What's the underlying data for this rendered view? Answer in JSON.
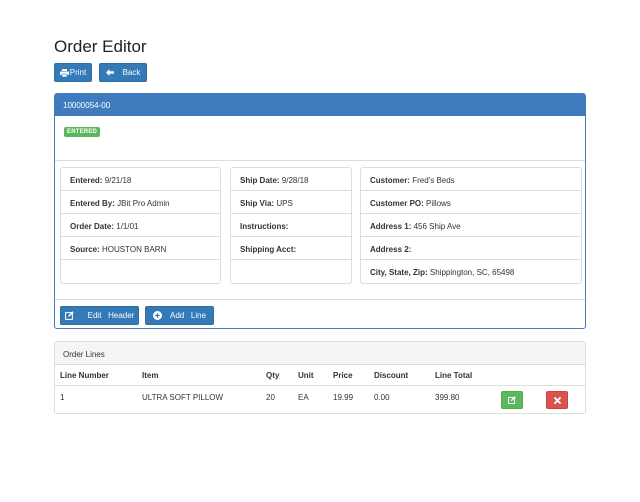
{
  "page": {
    "title": "Order Editor"
  },
  "toolbar": {
    "print_label": "Print",
    "back_label": "Back"
  },
  "order": {
    "number": "10000054-00",
    "status": "ENTERED",
    "col1": [
      {
        "label": "Entered:",
        "value": "9/21/18"
      },
      {
        "label": "Entered By:",
        "value": "JBit Pro Admin"
      },
      {
        "label": "Order Date:",
        "value": "1/1/01"
      },
      {
        "label": "Source:",
        "value": "HOUSTON BARN"
      }
    ],
    "col2": [
      {
        "label": "Ship Date:",
        "value": "9/28/18"
      },
      {
        "label": "Ship Via:",
        "value": "UPS"
      },
      {
        "label": "Instructions:",
        "value": ""
      },
      {
        "label": "Shipping Acct:",
        "value": ""
      }
    ],
    "col3": [
      {
        "label": "Customer:",
        "value": "Fred's Beds"
      },
      {
        "label": "Customer PO:",
        "value": "Pillows"
      },
      {
        "label": "Address 1:",
        "value": "456 Ship Ave"
      },
      {
        "label": "Address 2:",
        "value": ""
      },
      {
        "label": "City, State, Zip:",
        "value": "Shippington, SC, 65498"
      }
    ],
    "edit_header_label": "Edit   Header",
    "add_line_label": "Add   Line"
  },
  "lines": {
    "title": "Order Lines",
    "columns": [
      "Line Number",
      "Item",
      "Qty",
      "Unit",
      "Price",
      "Discount",
      "Line Total"
    ],
    "rows": [
      [
        "1",
        "ULTRA SOFT PILLOW",
        "20",
        "EA",
        "19.99",
        "0.00",
        "399.80"
      ]
    ]
  },
  "colors": {
    "primary": "#337ab7",
    "header": "#3f7bbd",
    "success": "#5cb85c",
    "danger": "#d9534f"
  },
  "icons": [
    "print-icon",
    "arrow-left-icon",
    "edit-icon",
    "plus-circle-icon",
    "edit-icon",
    "close-icon"
  ]
}
